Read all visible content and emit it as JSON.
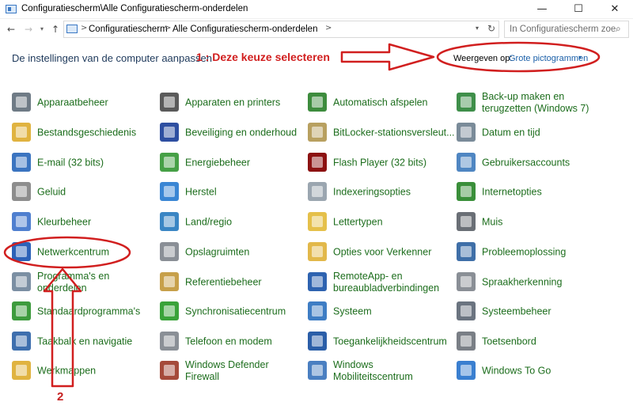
{
  "window": {
    "title": "Configuratiescherm\\Alle Configuratiescherm-onderdelen",
    "minimize": "—",
    "maximize": "☐",
    "close": "✕"
  },
  "nav": {
    "back": "←",
    "forward": "→",
    "recent": "▾",
    "up": "↑",
    "breadcrumb": [
      "Configuratiescherm",
      "Alle Configuratiescherm-onderdelen"
    ],
    "separator": ">",
    "dropdown": "▾",
    "refresh": "↻",
    "search_placeholder": "In Configuratiescherm zoeken",
    "search_icon": "⌕"
  },
  "header": {
    "title": "De instellingen van de computer aanpassen",
    "annotation1": "1 : Deze keuze selecteren",
    "view_by_label": "Weergeven op:",
    "view_by_value": "Grote pictogrammen",
    "caret": "▾"
  },
  "annotation2": "2",
  "items": [
    {
      "label": "Apparaatbeheer",
      "icon": "device-manager-icon",
      "color": "#6f7b86"
    },
    {
      "label": "Apparaten en printers",
      "icon": "devices-printers-icon",
      "color": "#5a5a5a"
    },
    {
      "label": "Automatisch afspelen",
      "icon": "autoplay-icon",
      "color": "#3d8c3d"
    },
    {
      "label": "Back-up maken en\nterugzetten (Windows 7)",
      "icon": "backup-icon",
      "color": "#3f8f4a"
    },
    {
      "label": "Bestandsgeschiedenis",
      "icon": "file-history-icon",
      "color": "#e0b340"
    },
    {
      "label": "Beveiliging en onderhoud",
      "icon": "security-flag-icon",
      "color": "#2e4fa1"
    },
    {
      "label": "BitLocker-stationsversleut...",
      "icon": "bitlocker-icon",
      "color": "#b8a060"
    },
    {
      "label": "Datum en tijd",
      "icon": "date-time-icon",
      "color": "#7a8b99"
    },
    {
      "label": "E-mail (32 bits)",
      "icon": "mail-icon",
      "color": "#3b74c0"
    },
    {
      "label": "Energiebeheer",
      "icon": "power-icon",
      "color": "#46a046"
    },
    {
      "label": "Flash Player (32 bits)",
      "icon": "flash-player-icon",
      "color": "#8c1212"
    },
    {
      "label": "Gebruikersaccounts",
      "icon": "user-accounts-icon",
      "color": "#4f86c2"
    },
    {
      "label": "Geluid",
      "icon": "sound-icon",
      "color": "#8d8d8d"
    },
    {
      "label": "Herstel",
      "icon": "recovery-icon",
      "color": "#3a86d4"
    },
    {
      "label": "Indexeringsopties",
      "icon": "indexing-icon",
      "color": "#9ba6b0"
    },
    {
      "label": "Internetopties",
      "icon": "internet-options-icon",
      "color": "#3a8f3a"
    },
    {
      "label": "Kleurbeheer",
      "icon": "color-management-icon",
      "color": "#4f7fcf"
    },
    {
      "label": "Land/regio",
      "icon": "region-globe-icon",
      "color": "#3a86c4"
    },
    {
      "label": "Lettertypen",
      "icon": "fonts-icon",
      "color": "#e5c04a"
    },
    {
      "label": "Muis",
      "icon": "mouse-icon",
      "color": "#6a6f76"
    },
    {
      "label": "Netwerkcentrum",
      "icon": "network-center-icon",
      "color": "#2c62b8"
    },
    {
      "label": "Opslagruimten",
      "icon": "storage-spaces-icon",
      "color": "#8a8f96"
    },
    {
      "label": "Opties voor Verkenner",
      "icon": "explorer-options-icon",
      "color": "#e2b84a"
    },
    {
      "label": "Probleemoplossing",
      "icon": "troubleshooting-icon",
      "color": "#3f6fa8"
    },
    {
      "label": "Programma's en\nonderdelen",
      "icon": "programs-icon",
      "color": "#7b8fa3"
    },
    {
      "label": "Referentiebeheer",
      "icon": "credential-manager-icon",
      "color": "#c7a04a"
    },
    {
      "label": "RemoteApp- en\nbureaubladverbindingen",
      "icon": "remoteapp-icon",
      "color": "#2e63b0"
    },
    {
      "label": "Spraakherkenning",
      "icon": "speech-mic-icon",
      "color": "#8a8f96"
    },
    {
      "label": "Standaardprogramma's",
      "icon": "default-programs-icon",
      "color": "#3d9b3d"
    },
    {
      "label": "Synchronisatiecentrum",
      "icon": "sync-center-icon",
      "color": "#3aa33a"
    },
    {
      "label": "Systeem",
      "icon": "system-icon",
      "color": "#3e7dc4"
    },
    {
      "label": "Systeembeheer",
      "icon": "admin-tools-icon",
      "color": "#6b7480"
    },
    {
      "label": "Taakbalk en navigatie",
      "icon": "taskbar-icon",
      "color": "#3e6fae"
    },
    {
      "label": "Telefoon en modem",
      "icon": "phone-modem-icon",
      "color": "#8a8f96"
    },
    {
      "label": "Toegankelijkheidscentrum",
      "icon": "ease-of-access-icon",
      "color": "#2b5ea8"
    },
    {
      "label": "Toetsenbord",
      "icon": "keyboard-icon",
      "color": "#7a7f86"
    },
    {
      "label": "Werkmappen",
      "icon": "work-folders-icon",
      "color": "#e0b340"
    },
    {
      "label": "Windows Defender\nFirewall",
      "icon": "firewall-icon",
      "color": "#a54a3a"
    },
    {
      "label": "Windows\nMobiliteitscentrum",
      "icon": "mobility-center-icon",
      "color": "#4a7fc1"
    },
    {
      "label": "Windows To Go",
      "icon": "windows-to-go-icon",
      "color": "#3a7fd0"
    }
  ],
  "colors": {
    "link_green": "#1c6d1c",
    "heading_blue": "#1e395b",
    "annotation_red": "#d11f1f"
  }
}
